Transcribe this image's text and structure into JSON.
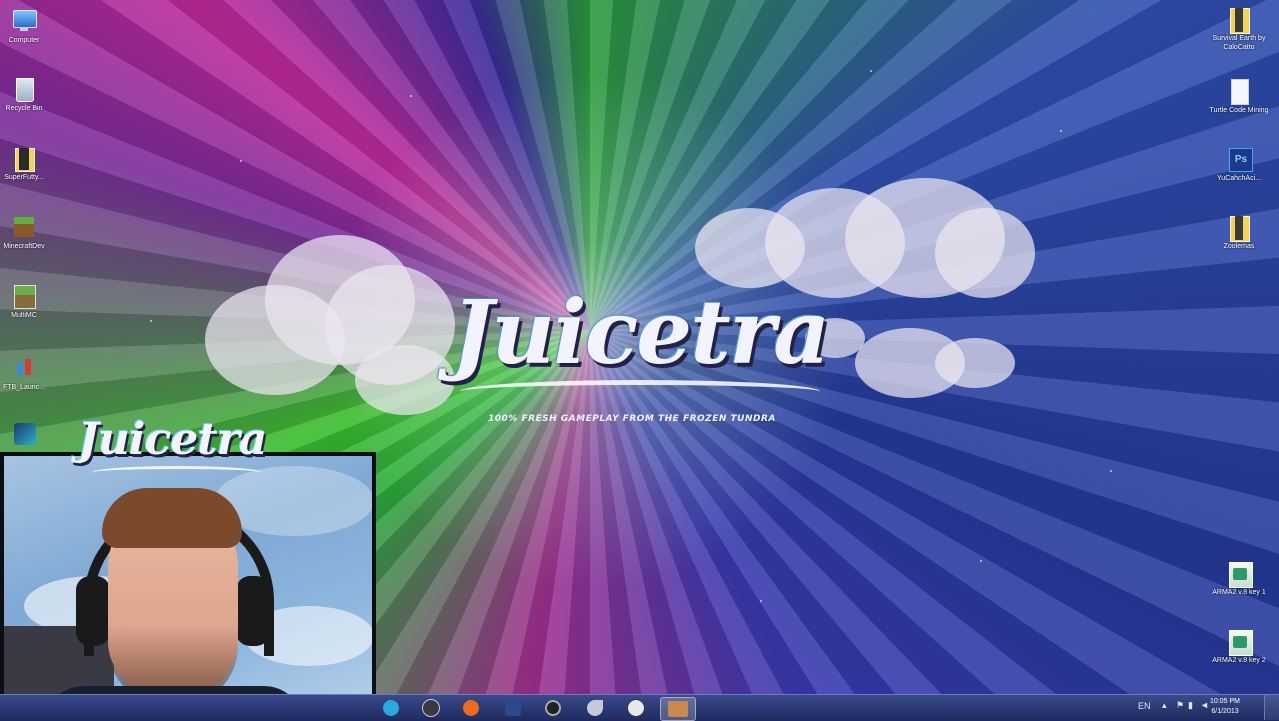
{
  "wallpaper": {
    "title": "Juicetra",
    "tagline": "100% FRESH GAMEPLAY FROM THE FROZEN TUNDRA"
  },
  "desktop_icons_left": [
    {
      "label": "Computer",
      "icon": "computer-icon"
    },
    {
      "label": "Recycle Bin",
      "icon": "recycle-bin-icon"
    },
    {
      "label": "SuperFutty...",
      "icon": "folder-icon"
    },
    {
      "label": "MinecraftDev",
      "icon": "minecraft-icon"
    },
    {
      "label": "MultiMC",
      "icon": "multimc-icon"
    },
    {
      "label": "FTB_Launc...",
      "icon": "ftb-icon"
    },
    {
      "label": "",
      "icon": "app-icon"
    }
  ],
  "desktop_icons_right": [
    {
      "label": "Survival Earth by CaloCatto",
      "icon": "folder-icon"
    },
    {
      "label": "Turtle Code Mining",
      "icon": "text-file-icon"
    },
    {
      "label": "YuCahchAci...",
      "icon": "photoshop-icon"
    },
    {
      "label": "Zoolemas",
      "icon": "folder-icon"
    },
    {
      "label": "ARMA2 v.8 key 1",
      "icon": "arma-shortcut-icon"
    },
    {
      "label": "ARMA2 v.8 key 2",
      "icon": "arma-shortcut-icon"
    }
  ],
  "webcam": {
    "overlay_title": "Juicetra"
  },
  "taskbar": {
    "apps": [
      {
        "name": "skype",
        "color": "#2aa9e0"
      },
      {
        "name": "steam",
        "color": "#3a3a44"
      },
      {
        "name": "origin",
        "color": "#f06a1e"
      },
      {
        "name": "teamspeak",
        "color": "#2a4a8a"
      },
      {
        "name": "obs",
        "color": "#222222"
      },
      {
        "name": "curse",
        "color": "#c8c8d8"
      },
      {
        "name": "inkscape",
        "color": "#e8e8e8"
      },
      {
        "name": "minecraft-window",
        "color": "#c88a4a"
      }
    ],
    "tray_text": "EN",
    "clock_time": "10:05 PM",
    "clock_date": "6/1/2013"
  }
}
